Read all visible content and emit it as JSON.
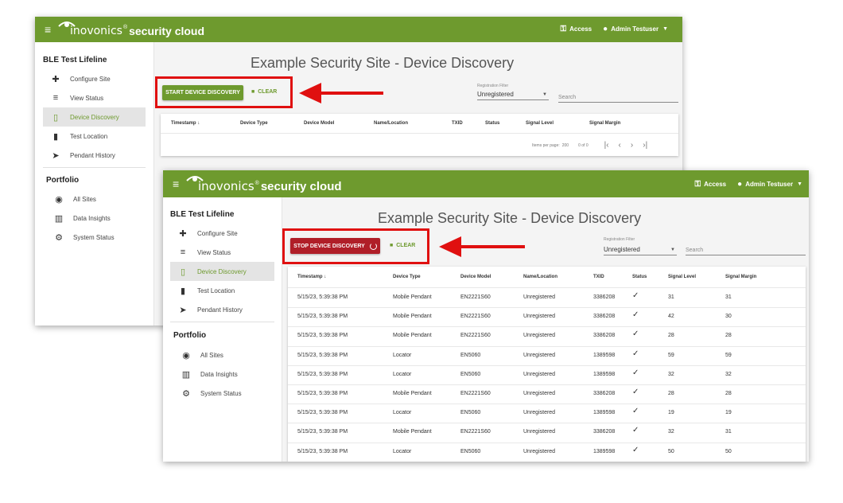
{
  "app": {
    "brand": "inovonics",
    "trademark": "®",
    "brand_rest": " security cloud",
    "access_label": "Access",
    "user_label": "Admin Testuser"
  },
  "sidebar": {
    "site_title": "BLE Test Lifeline",
    "site_items": [
      {
        "label": "Configure Site",
        "icon": "puzzle-icon"
      },
      {
        "label": "View Status",
        "icon": "view-status-icon"
      },
      {
        "label": "Device Discovery",
        "icon": "device-discovery-icon"
      },
      {
        "label": "Test Location",
        "icon": "test-tube-icon"
      },
      {
        "label": "Pendant History",
        "icon": "navigation-arrow-icon"
      }
    ],
    "portfolio_title": "Portfolio",
    "portfolio_items": [
      {
        "label": "All Sites",
        "icon": "location-icon"
      },
      {
        "label": "Data Insights",
        "icon": "bar-chart-icon"
      },
      {
        "label": "System Status",
        "icon": "gear-icon"
      }
    ]
  },
  "page": {
    "title": "Example Security Site - Device Discovery",
    "start_button": "START DEVICE DISCOVERY",
    "stop_button": "STOP DEVICE DISCOVERY",
    "clear_button": "CLEAR",
    "filter_label": "Registration Filter",
    "filter_value": "Unregistered",
    "search_placeholder": "Search"
  },
  "table": {
    "headers": [
      "Timestamp ↓",
      "Device Type",
      "Device Model",
      "Name/Location",
      "TXID",
      "Status",
      "Signal Level",
      "Signal Margin"
    ],
    "rows": [
      [
        "5/15/23, 5:39:38 PM",
        "Mobile Pendant",
        "EN2221S60",
        "Unregistered",
        "3386208",
        "✓",
        "31",
        "31"
      ],
      [
        "5/15/23, 5:39:38 PM",
        "Mobile Pendant",
        "EN2221S60",
        "Unregistered",
        "3386208",
        "✓",
        "42",
        "30"
      ],
      [
        "5/15/23, 5:39:38 PM",
        "Mobile Pendant",
        "EN2221S60",
        "Unregistered",
        "3386208",
        "✓",
        "28",
        "28"
      ],
      [
        "5/15/23, 5:39:38 PM",
        "Locator",
        "EN5060",
        "Unregistered",
        "1389598",
        "✓",
        "59",
        "59"
      ],
      [
        "5/15/23, 5:39:38 PM",
        "Locator",
        "EN5060",
        "Unregistered",
        "1389598",
        "✓",
        "32",
        "32"
      ],
      [
        "5/15/23, 5:39:38 PM",
        "Mobile Pendant",
        "EN2221S60",
        "Unregistered",
        "3386208",
        "✓",
        "28",
        "28"
      ],
      [
        "5/15/23, 5:39:38 PM",
        "Locator",
        "EN5060",
        "Unregistered",
        "1389598",
        "✓",
        "19",
        "19"
      ],
      [
        "5/15/23, 5:39:38 PM",
        "Mobile Pendant",
        "EN2221S60",
        "Unregistered",
        "3386208",
        "✓",
        "32",
        "31"
      ],
      [
        "5/15/23, 5:39:38 PM",
        "Locator",
        "EN5060",
        "Unregistered",
        "1389598",
        "✓",
        "50",
        "50"
      ]
    ],
    "pager": {
      "items_per_page_label": "Items per page:",
      "items_per_page_value": "200",
      "range": "0 of 0"
    }
  },
  "colors": {
    "brand_green": "#6e9a2e",
    "start_button": "#6e9a2e",
    "stop_button": "#b01e28",
    "highlight_red": "#e01010"
  }
}
